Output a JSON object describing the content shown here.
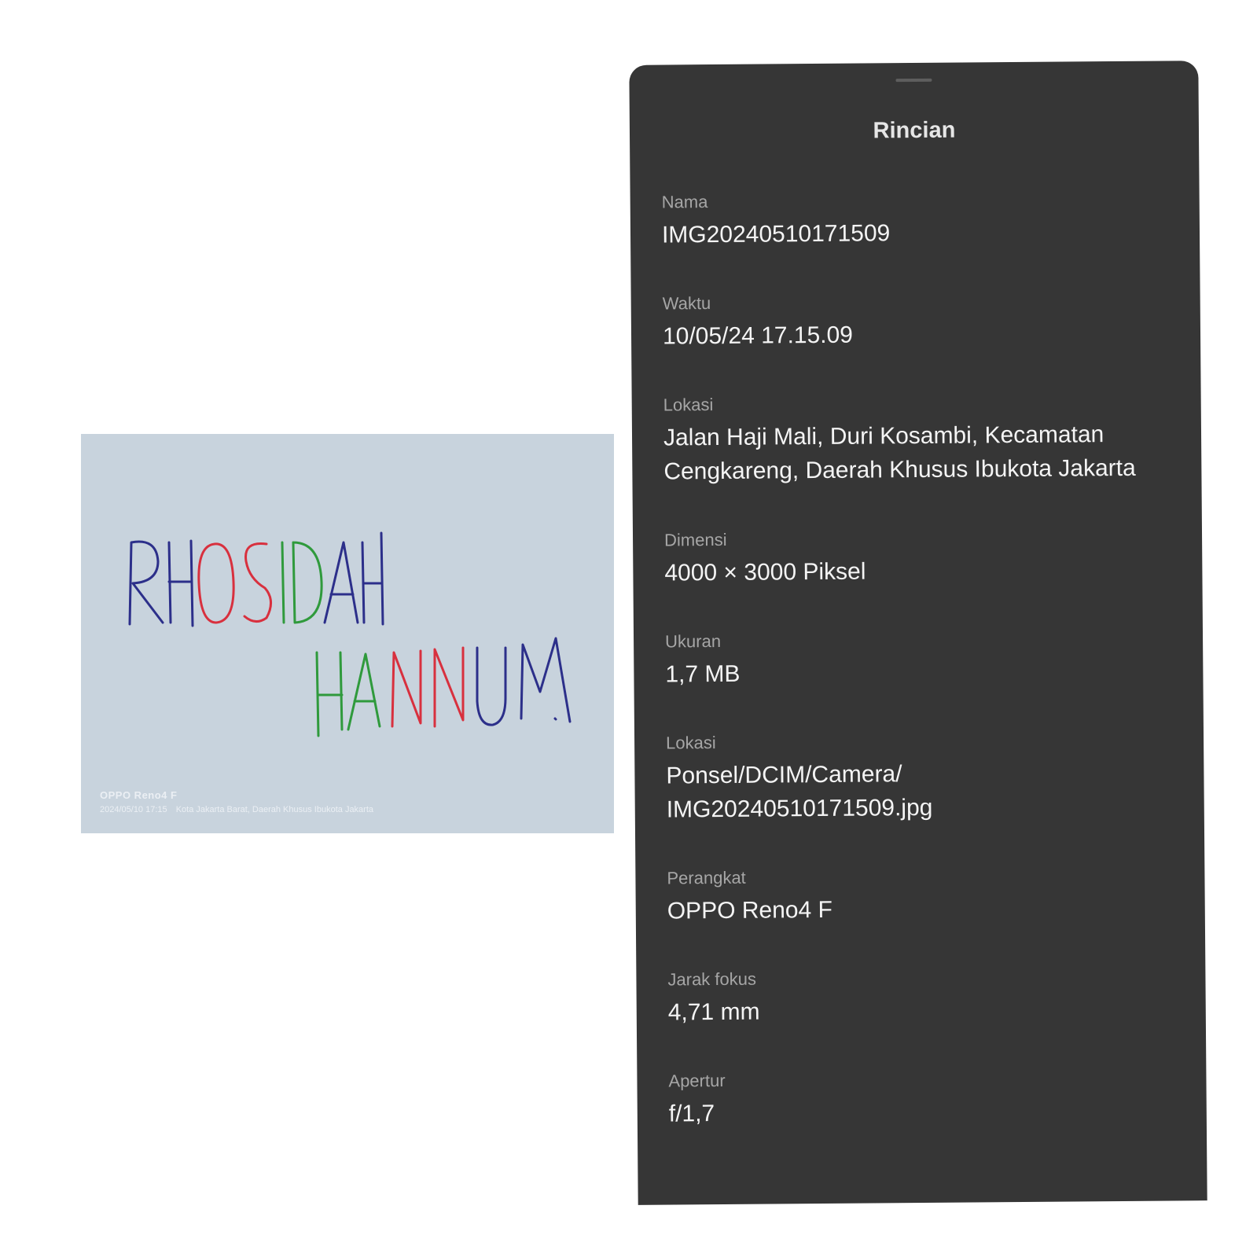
{
  "photo": {
    "handwritten_text": [
      "RHOSIDAH",
      "HANNUM"
    ],
    "stamp_device": "OPPO Reno4 F",
    "stamp_datetime": "2024/05/10 17:15",
    "stamp_location": "Kota Jakarta Barat, Daerah Khusus Ibukota Jakarta",
    "ink_colors": {
      "blue": "#2c2f8a",
      "red": "#d8303e",
      "green": "#2f9a3c"
    }
  },
  "details": {
    "title": "Rincian",
    "fields": [
      {
        "label": "Nama",
        "value": "IMG20240510171509"
      },
      {
        "label": "Waktu",
        "value": "10/05/24 17.15.09"
      },
      {
        "label": "Lokasi",
        "value": "Jalan Haji Mali, Duri Kosambi, Kecamatan Cengkareng, Daerah Khusus Ibukota Jakarta"
      },
      {
        "label": "Dimensi",
        "value": "4000 × 3000 Piksel"
      },
      {
        "label": "Ukuran",
        "value": "1,7 MB"
      },
      {
        "label": "Lokasi",
        "value": "Ponsel/DCIM/Camera/\nIMG20240510171509.jpg"
      },
      {
        "label": "Perangkat",
        "value": "OPPO Reno4 F"
      },
      {
        "label": "Jarak fokus",
        "value": "4,71 mm"
      },
      {
        "label": "Apertur",
        "value": "f/1,7"
      }
    ]
  },
  "colors": {
    "panel_background": "#363636",
    "label_text": "#a6a6a6",
    "value_text": "#f4f4f4",
    "paper": "#c8d3dd"
  }
}
